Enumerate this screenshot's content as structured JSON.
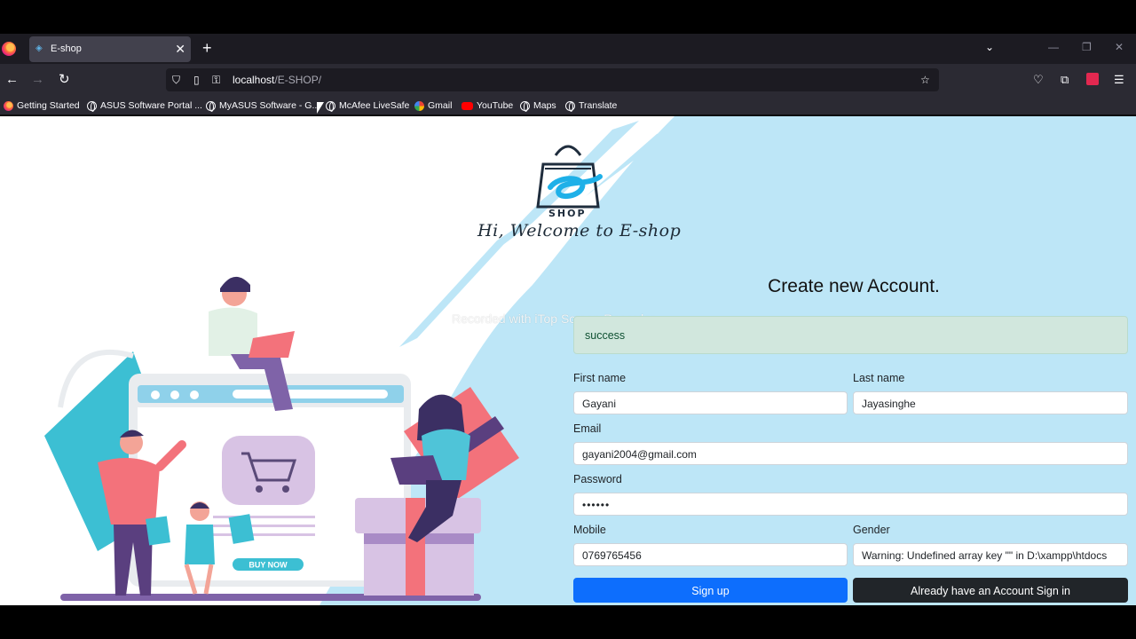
{
  "browser": {
    "tab_title": "E-shop",
    "tab_close": "✕",
    "new_tab": "+",
    "url_host": "localhost",
    "url_path": "/E-SHOP/",
    "bookmarks": [
      "Getting Started",
      "ASUS Software Portal ...",
      "MyASUS Software - G...",
      "McAfee LiveSafe",
      "Gmail",
      "YouTube",
      "Maps",
      "Translate"
    ]
  },
  "icons": {
    "back": "back-arrow-icon",
    "forward": "forward-arrow-icon",
    "reload": "reload-icon",
    "shield": "shield-icon",
    "page": "page-icon",
    "key": "key-icon",
    "star": "bookmark-star-icon",
    "pocket": "pocket-icon",
    "extensions": "extensions-icon",
    "addon": "addon-icon",
    "menu": "hamburger-menu-icon"
  },
  "page": {
    "logo_text": "SHOP",
    "welcome": "Hi, Welcome to E-shop",
    "watermark": "Recorded with iTop Screen Recorder",
    "illustration_button": "BUY NOW",
    "form": {
      "title": "Create new Account.",
      "alert": "success",
      "first_name_label": "First name",
      "first_name_value": "Gayani",
      "last_name_label": "Last name",
      "last_name_value": "Jayasinghe",
      "email_label": "Email",
      "email_value": "gayani2004@gmail.com",
      "password_label": "Password",
      "password_value": "••••••",
      "mobile_label": "Mobile",
      "mobile_value": "0769765456",
      "gender_label": "Gender",
      "gender_value": "Warning: Undefined array key \"\" in D:\\xampp\\htdocs",
      "signup_label": "Sign up",
      "signin_label": "Already have an Account Sign in"
    }
  },
  "colors": {
    "primary": "#0d6efd",
    "dark": "#212529",
    "light_blue": "#bde6f7",
    "alert_bg": "#d1e7dd"
  }
}
